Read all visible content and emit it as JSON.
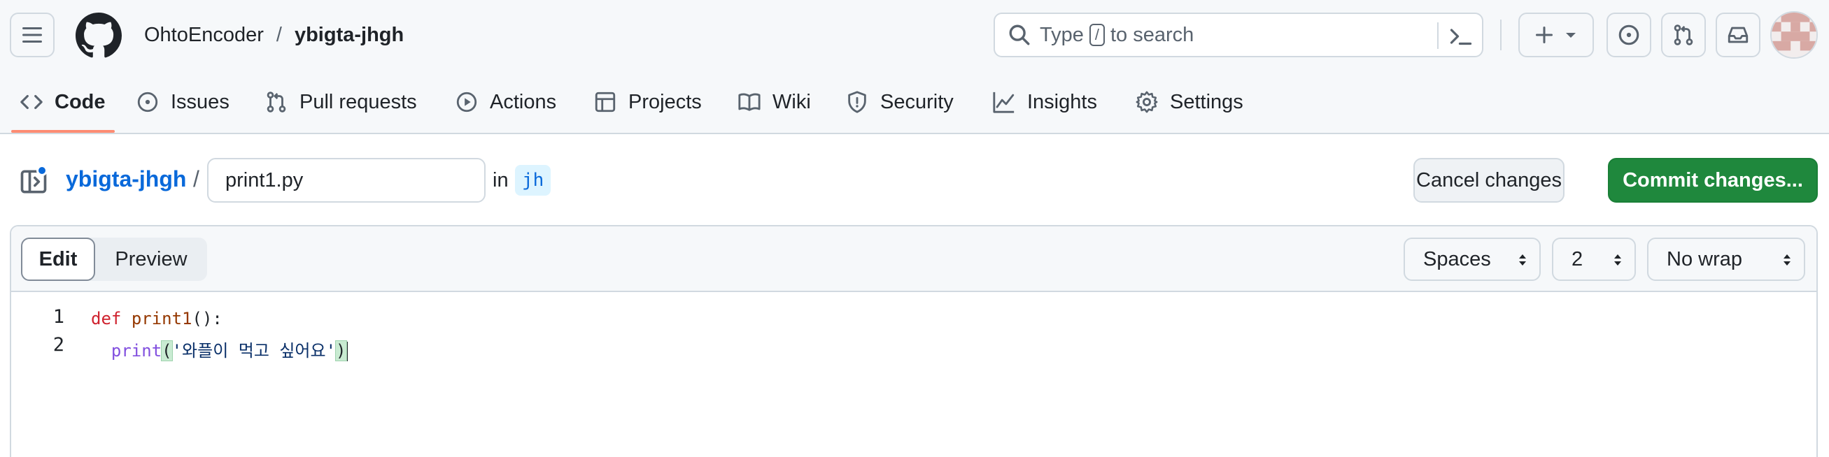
{
  "header": {
    "owner": "OhtoEncoder",
    "separator": "/",
    "repo": "ybigta-jhgh",
    "search": {
      "prefix": "Type",
      "key": "/",
      "suffix": "to search"
    }
  },
  "nav": {
    "items": [
      {
        "label": "Code",
        "icon": "code-icon",
        "selected": true
      },
      {
        "label": "Issues",
        "icon": "issue-icon"
      },
      {
        "label": "Pull requests",
        "icon": "pull-request-icon"
      },
      {
        "label": "Actions",
        "icon": "play-icon"
      },
      {
        "label": "Projects",
        "icon": "table-icon"
      },
      {
        "label": "Wiki",
        "icon": "book-icon"
      },
      {
        "label": "Security",
        "icon": "shield-icon"
      },
      {
        "label": "Insights",
        "icon": "graph-icon"
      },
      {
        "label": "Settings",
        "icon": "gear-icon"
      }
    ]
  },
  "editor_toolbar": {
    "repo_link": "ybigta-jhgh",
    "separator": "/",
    "filename": "print1.py",
    "in_label": "in",
    "branch": "jh",
    "cancel_label": "Cancel changes",
    "commit_label": "Commit changes..."
  },
  "editor": {
    "tabs": [
      {
        "label": "Edit",
        "selected": true
      },
      {
        "label": "Preview",
        "selected": false
      }
    ],
    "indent_mode": "Spaces",
    "indent_size": "2",
    "wrap_mode": "No wrap",
    "lines": [
      {
        "number": "1",
        "text": "def print1():"
      },
      {
        "number": "2",
        "text": "  print('와플이 먹고 싶어요')"
      }
    ]
  },
  "colors": {
    "accent_blue": "#0969da",
    "commit_green": "#1f883d",
    "nav_underline": "#fd8c73",
    "keyword": "#cf222e",
    "function_builtin": "#8250df",
    "function_name": "#953800",
    "string": "#0a3069"
  }
}
